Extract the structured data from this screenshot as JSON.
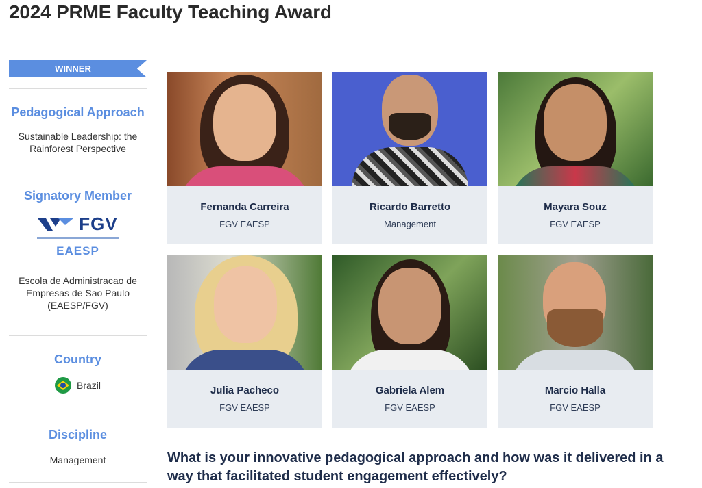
{
  "page": {
    "title": "2024 PRME Faculty Teaching Award"
  },
  "sidebar": {
    "banner": "WINNER",
    "pedagogical_approach": {
      "heading": "Pedagogical Approach",
      "text_line1": "Sustainable Leadership: the",
      "text_line2": "Rainforest Perspective"
    },
    "signatory_member": {
      "heading": "Signatory Member",
      "logo_top": "FGV",
      "logo_bottom": "EAESP",
      "name_line1": "Escola de Administracao de",
      "name_line2": "Empresas de Sao Paulo",
      "name_line3": "(EAESP/FGV)"
    },
    "country": {
      "heading": "Country",
      "value": "Brazil",
      "flag_icon": "brazil-flag-icon"
    },
    "discipline": {
      "heading": "Discipline",
      "value": "Management"
    }
  },
  "team": [
    {
      "name": "Fernanda Carreira",
      "affiliation": "FGV EAESP"
    },
    {
      "name": "Ricardo Barretto",
      "affiliation": "Management"
    },
    {
      "name": "Mayara Souz",
      "affiliation": "FGV EAESP"
    },
    {
      "name": "Julia Pacheco",
      "affiliation": "FGV EAESP"
    },
    {
      "name": "Gabriela Alem",
      "affiliation": "FGV EAESP"
    },
    {
      "name": "Marcio Halla",
      "affiliation": "FGV EAESP"
    }
  ],
  "question": {
    "line1": "What is your innovative pedagogical approach and how was it delivered in a",
    "line2": "way that facilitated student engagement effectively?"
  },
  "colors": {
    "accent": "#5b8ee0",
    "card_bg": "#e8ecf1",
    "navy_text": "#1f2d4a"
  }
}
